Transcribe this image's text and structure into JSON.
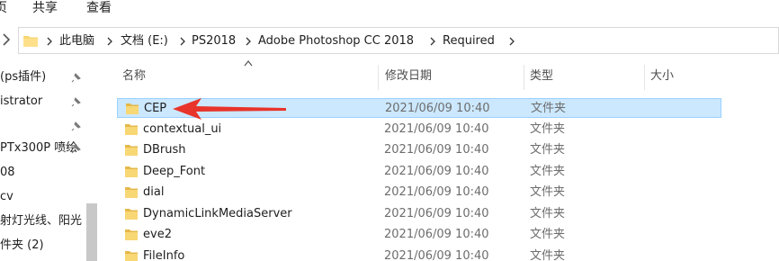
{
  "ribbon": {
    "tabs": [
      "页",
      "共享",
      "查看"
    ]
  },
  "address": {
    "crumbs": [
      "此电脑",
      "文档 (E:)",
      "PS2018",
      "Adobe Photoshop CC 2018",
      "Required"
    ]
  },
  "nav_pane": {
    "items": [
      {
        "label": "(ps插件)",
        "pinned": true
      },
      {
        "label": "istrator",
        "pinned": true
      },
      {
        "label": "",
        "pinned": true
      },
      {
        "label": "PTx300P 喷绘",
        "pinned": true
      },
      {
        "label": "08",
        "pinned": false
      },
      {
        "label": "cv",
        "pinned": false
      },
      {
        "label": "射灯光线、阳光",
        "pinned": false
      },
      {
        "label": "件夹 (2)",
        "pinned": false
      },
      {
        "label": "",
        "pinned": false
      }
    ]
  },
  "file_list": {
    "columns": {
      "name": "名称",
      "date": "修改日期",
      "type": "类型",
      "size": "大小"
    },
    "rows": [
      {
        "name": "CEP",
        "date": "2021/06/09 10:40",
        "type": "文件夹",
        "selected": true
      },
      {
        "name": "contextual_ui",
        "date": "2021/06/09 10:40",
        "type": "文件夹",
        "selected": false
      },
      {
        "name": "DBrush",
        "date": "2021/06/09 10:40",
        "type": "文件夹",
        "selected": false
      },
      {
        "name": "Deep_Font",
        "date": "2021/06/09 10:40",
        "type": "文件夹",
        "selected": false
      },
      {
        "name": "dial",
        "date": "2021/06/09 10:40",
        "type": "文件夹",
        "selected": false
      },
      {
        "name": "DynamicLinkMediaServer",
        "date": "2021/06/09 10:40",
        "type": "文件夹",
        "selected": false
      },
      {
        "name": "eve2",
        "date": "2021/06/09 10:40",
        "type": "文件夹",
        "selected": false
      },
      {
        "name": "FileInfo",
        "date": "2021/06/09 10:40",
        "type": "文件夹",
        "selected": false
      }
    ]
  },
  "colors": {
    "selection_fill": "#cce8ff",
    "selection_border": "#99d1ff",
    "folder": "#f8d775",
    "annotation_arrow": "#e8342a"
  },
  "icons": {
    "folder": "folder-icon",
    "pin": "pin-icon",
    "chevron": "chevron-right-icon",
    "sort": "sort-up-icon",
    "arrow": "annotation-arrow-icon"
  }
}
